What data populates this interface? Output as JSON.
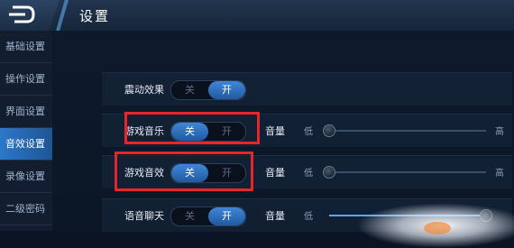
{
  "header": {
    "title": "设置"
  },
  "sidebar": {
    "items": [
      {
        "label": "基础设置",
        "active": false
      },
      {
        "label": "操作设置",
        "active": false
      },
      {
        "label": "界面设置",
        "active": false
      },
      {
        "label": "音效设置",
        "active": true
      },
      {
        "label": "录像设置",
        "active": false
      },
      {
        "label": "二级密码",
        "active": false
      }
    ]
  },
  "settings": {
    "vibration": {
      "label": "震动效果",
      "off": "关",
      "on": "开",
      "value": "开"
    },
    "game_music": {
      "label": "游戏音乐",
      "off": "关",
      "on": "开",
      "value": "关",
      "volume_label": "音量",
      "low": "低",
      "high": "高",
      "volume_percent": 0
    },
    "game_sfx": {
      "label": "游戏音效",
      "off": "关",
      "on": "开",
      "value": "关",
      "volume_label": "音量",
      "low": "低",
      "high": "高",
      "volume_percent": 0
    },
    "voice_chat": {
      "label": "语音聊天",
      "off": "关",
      "on": "开",
      "value": "开",
      "volume_label": "音量",
      "low": "低",
      "high": "高",
      "volume_percent": 100
    }
  },
  "colors": {
    "accent": "#2d78c9",
    "highlight": "#e8252b",
    "background": "#0b1424"
  }
}
